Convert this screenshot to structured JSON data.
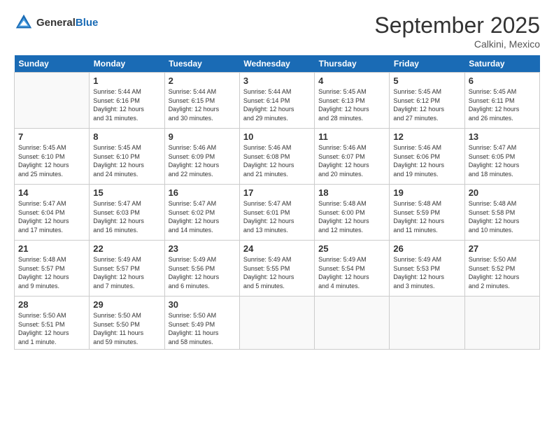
{
  "header": {
    "logo_line1": "General",
    "logo_line2": "Blue",
    "month": "September 2025",
    "location": "Calkini, Mexico"
  },
  "weekdays": [
    "Sunday",
    "Monday",
    "Tuesday",
    "Wednesday",
    "Thursday",
    "Friday",
    "Saturday"
  ],
  "weeks": [
    [
      {
        "num": "",
        "info": ""
      },
      {
        "num": "1",
        "info": "Sunrise: 5:44 AM\nSunset: 6:16 PM\nDaylight: 12 hours\nand 31 minutes."
      },
      {
        "num": "2",
        "info": "Sunrise: 5:44 AM\nSunset: 6:15 PM\nDaylight: 12 hours\nand 30 minutes."
      },
      {
        "num": "3",
        "info": "Sunrise: 5:44 AM\nSunset: 6:14 PM\nDaylight: 12 hours\nand 29 minutes."
      },
      {
        "num": "4",
        "info": "Sunrise: 5:45 AM\nSunset: 6:13 PM\nDaylight: 12 hours\nand 28 minutes."
      },
      {
        "num": "5",
        "info": "Sunrise: 5:45 AM\nSunset: 6:12 PM\nDaylight: 12 hours\nand 27 minutes."
      },
      {
        "num": "6",
        "info": "Sunrise: 5:45 AM\nSunset: 6:11 PM\nDaylight: 12 hours\nand 26 minutes."
      }
    ],
    [
      {
        "num": "7",
        "info": "Sunrise: 5:45 AM\nSunset: 6:10 PM\nDaylight: 12 hours\nand 25 minutes."
      },
      {
        "num": "8",
        "info": "Sunrise: 5:45 AM\nSunset: 6:10 PM\nDaylight: 12 hours\nand 24 minutes."
      },
      {
        "num": "9",
        "info": "Sunrise: 5:46 AM\nSunset: 6:09 PM\nDaylight: 12 hours\nand 22 minutes."
      },
      {
        "num": "10",
        "info": "Sunrise: 5:46 AM\nSunset: 6:08 PM\nDaylight: 12 hours\nand 21 minutes."
      },
      {
        "num": "11",
        "info": "Sunrise: 5:46 AM\nSunset: 6:07 PM\nDaylight: 12 hours\nand 20 minutes."
      },
      {
        "num": "12",
        "info": "Sunrise: 5:46 AM\nSunset: 6:06 PM\nDaylight: 12 hours\nand 19 minutes."
      },
      {
        "num": "13",
        "info": "Sunrise: 5:47 AM\nSunset: 6:05 PM\nDaylight: 12 hours\nand 18 minutes."
      }
    ],
    [
      {
        "num": "14",
        "info": "Sunrise: 5:47 AM\nSunset: 6:04 PM\nDaylight: 12 hours\nand 17 minutes."
      },
      {
        "num": "15",
        "info": "Sunrise: 5:47 AM\nSunset: 6:03 PM\nDaylight: 12 hours\nand 16 minutes."
      },
      {
        "num": "16",
        "info": "Sunrise: 5:47 AM\nSunset: 6:02 PM\nDaylight: 12 hours\nand 14 minutes."
      },
      {
        "num": "17",
        "info": "Sunrise: 5:47 AM\nSunset: 6:01 PM\nDaylight: 12 hours\nand 13 minutes."
      },
      {
        "num": "18",
        "info": "Sunrise: 5:48 AM\nSunset: 6:00 PM\nDaylight: 12 hours\nand 12 minutes."
      },
      {
        "num": "19",
        "info": "Sunrise: 5:48 AM\nSunset: 5:59 PM\nDaylight: 12 hours\nand 11 minutes."
      },
      {
        "num": "20",
        "info": "Sunrise: 5:48 AM\nSunset: 5:58 PM\nDaylight: 12 hours\nand 10 minutes."
      }
    ],
    [
      {
        "num": "21",
        "info": "Sunrise: 5:48 AM\nSunset: 5:57 PM\nDaylight: 12 hours\nand 9 minutes."
      },
      {
        "num": "22",
        "info": "Sunrise: 5:49 AM\nSunset: 5:57 PM\nDaylight: 12 hours\nand 7 minutes."
      },
      {
        "num": "23",
        "info": "Sunrise: 5:49 AM\nSunset: 5:56 PM\nDaylight: 12 hours\nand 6 minutes."
      },
      {
        "num": "24",
        "info": "Sunrise: 5:49 AM\nSunset: 5:55 PM\nDaylight: 12 hours\nand 5 minutes."
      },
      {
        "num": "25",
        "info": "Sunrise: 5:49 AM\nSunset: 5:54 PM\nDaylight: 12 hours\nand 4 minutes."
      },
      {
        "num": "26",
        "info": "Sunrise: 5:49 AM\nSunset: 5:53 PM\nDaylight: 12 hours\nand 3 minutes."
      },
      {
        "num": "27",
        "info": "Sunrise: 5:50 AM\nSunset: 5:52 PM\nDaylight: 12 hours\nand 2 minutes."
      }
    ],
    [
      {
        "num": "28",
        "info": "Sunrise: 5:50 AM\nSunset: 5:51 PM\nDaylight: 12 hours\nand 1 minute."
      },
      {
        "num": "29",
        "info": "Sunrise: 5:50 AM\nSunset: 5:50 PM\nDaylight: 11 hours\nand 59 minutes."
      },
      {
        "num": "30",
        "info": "Sunrise: 5:50 AM\nSunset: 5:49 PM\nDaylight: 11 hours\nand 58 minutes."
      },
      {
        "num": "",
        "info": ""
      },
      {
        "num": "",
        "info": ""
      },
      {
        "num": "",
        "info": ""
      },
      {
        "num": "",
        "info": ""
      }
    ]
  ]
}
